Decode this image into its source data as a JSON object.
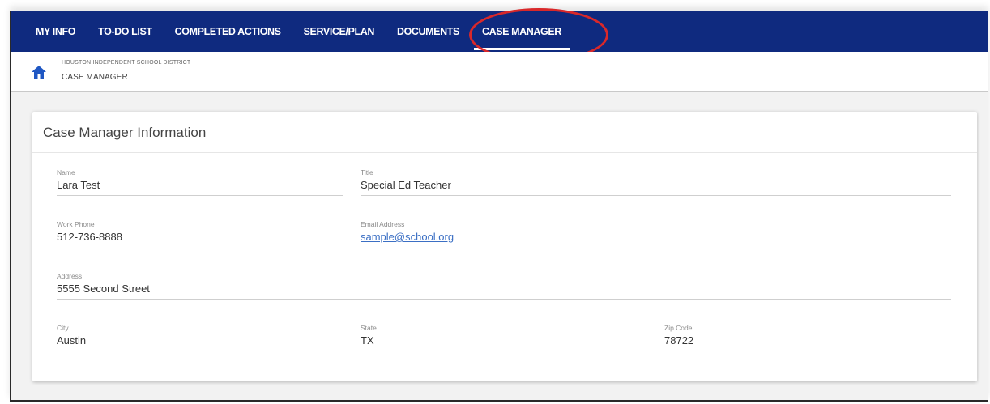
{
  "nav": {
    "items": [
      {
        "label": "MY INFO"
      },
      {
        "label": "TO-DO LIST"
      },
      {
        "label": "COMPLETED ACTIONS"
      },
      {
        "label": "SERVICE/PLAN"
      },
      {
        "label": "DOCUMENTS"
      },
      {
        "label": "CASE MANAGER"
      }
    ],
    "active": "CASE MANAGER",
    "color": "#0f2a7f"
  },
  "breadcrumb": {
    "district": "HOUSTON INDEPENDENT SCHOOL DISTRICT",
    "page": "CASE MANAGER",
    "icon": "home-icon"
  },
  "card": {
    "title": "Case Manager Information",
    "fields": {
      "name": {
        "label": "Name",
        "value": "Lara Test"
      },
      "title": {
        "label": "Title",
        "value": "Special Ed Teacher"
      },
      "work_phone": {
        "label": "Work Phone",
        "value": "512-736-8888"
      },
      "email": {
        "label": "Email Address",
        "value": "sample@school.org"
      },
      "address": {
        "label": "Address",
        "value": "5555 Second Street"
      },
      "city": {
        "label": "City",
        "value": "Austin"
      },
      "state": {
        "label": "State",
        "value": "TX"
      },
      "zip": {
        "label": "Zip Code",
        "value": "78722"
      }
    }
  },
  "annotation_color": "#d9282a"
}
